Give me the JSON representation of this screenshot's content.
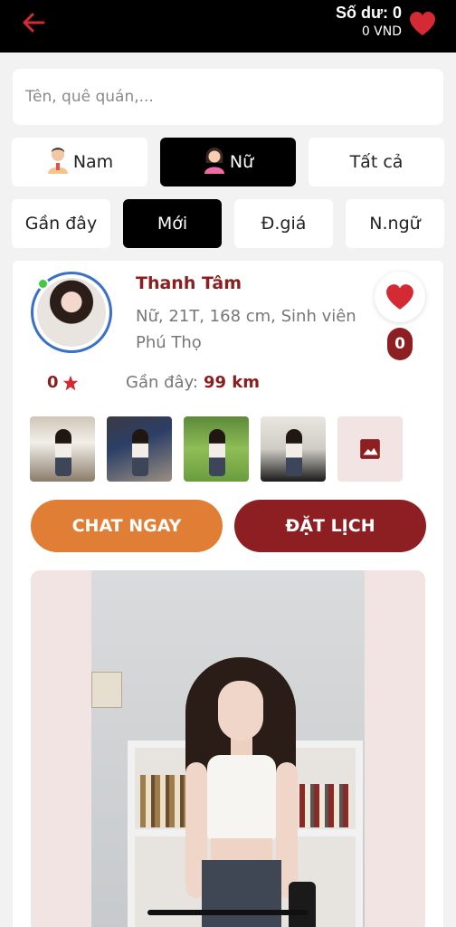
{
  "header": {
    "balance_label": "Số dư: 0",
    "balance_amount": "0 VND",
    "accent_color": "#d42a33"
  },
  "search": {
    "placeholder": "Tên, quê quán,..."
  },
  "gender_filters": [
    {
      "label": "Nam",
      "icon": "male-avatar-icon",
      "active": false
    },
    {
      "label": "Nữ",
      "icon": "female-avatar-icon",
      "active": true
    },
    {
      "label": "Tất cả",
      "active": false
    }
  ],
  "sort_filters": [
    {
      "label": "Gần đây",
      "active": false
    },
    {
      "label": "Mới",
      "active": true
    },
    {
      "label": "Đ.giá",
      "active": false
    },
    {
      "label": "N.ngữ",
      "active": false
    }
  ],
  "profile": {
    "name": "Thanh Tâm",
    "details": "Nữ, 21T, 168 cm, Sinh viên",
    "hometown": "Phú Thọ",
    "online": true,
    "like_count": "0",
    "rating": "0",
    "distance_label": "Gần đây:",
    "distance_value": "99 km",
    "thumbnails": [
      "photo-1",
      "photo-2",
      "photo-3",
      "photo-4"
    ],
    "more_icon": "image-gallery-icon"
  },
  "actions": {
    "chat_label": "CHAT NGAY",
    "book_label": "ĐẶT LỊCH",
    "chat_color": "#e07e35",
    "book_color": "#8d1f22"
  }
}
